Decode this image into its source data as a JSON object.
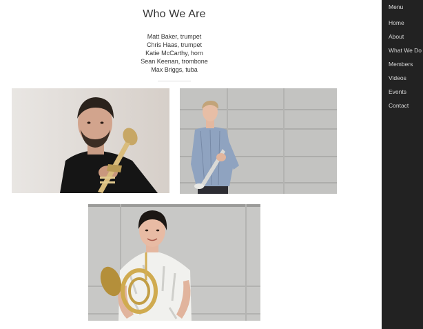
{
  "main": {
    "title": "Who We Are",
    "members": [
      "Matt Baker, trumpet",
      "Chris Haas, trumpet",
      "Katie McCarthy, horn",
      "Sean Keenan, trombone",
      "Max Briggs, tuba"
    ],
    "photos": [
      {
        "subject": "trumpet-player-portrait"
      },
      {
        "subject": "trumpet-player-standing"
      },
      {
        "subject": "horn-player-portrait"
      }
    ]
  },
  "sidebar": {
    "menu_label": "Menu",
    "items": [
      "Home",
      "About",
      "What We Do",
      "Members",
      "Videos",
      "Events",
      "Contact"
    ]
  },
  "colors": {
    "sidebar_bg": "#222222",
    "sidebar_text": "#d8d8d8",
    "body_text": "#333333",
    "page_bg": "#ffffff"
  }
}
